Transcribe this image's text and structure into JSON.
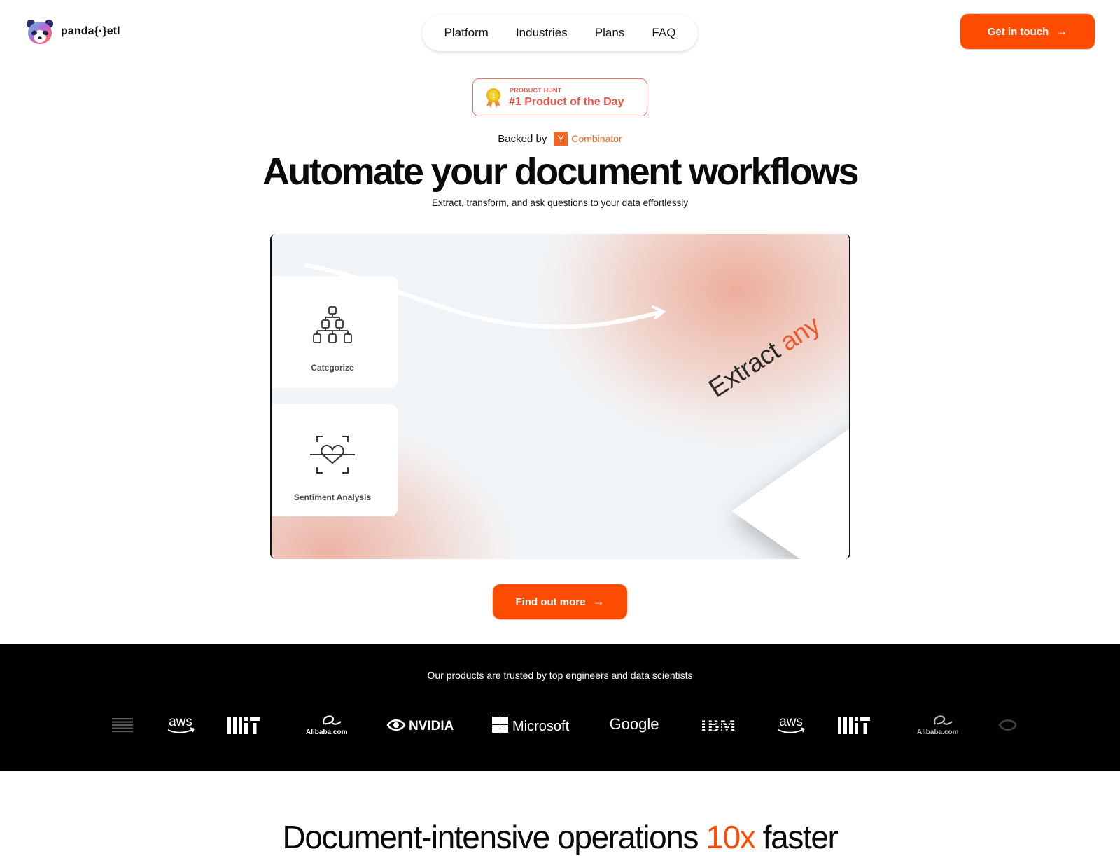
{
  "brand": {
    "name": "panda{·}etl",
    "accent_color": "#fc4c02"
  },
  "nav": {
    "items": [
      {
        "label": "Platform"
      },
      {
        "label": "Industries"
      },
      {
        "label": "Plans"
      },
      {
        "label": "FAQ"
      }
    ]
  },
  "header": {
    "cta_label": "Get in touch",
    "cta_icon": "arrow-right-icon"
  },
  "badge": {
    "small_label": "PRODUCT HUNT",
    "big_label": "#1 Product of the Day",
    "medal_number": "1",
    "icon": "medal-icon"
  },
  "backed_by": {
    "label": "Backed by",
    "yc_letter": "Y",
    "yc_name": "Combinator"
  },
  "hero": {
    "title": "Automate your document workflows",
    "subtitle": "Extract, transform, and ask questions to your data effortlessly",
    "cards": [
      {
        "label": "Categorize",
        "icon": "hierarchy-icon"
      },
      {
        "label": "Sentiment Analysis",
        "icon": "heart-scan-icon"
      }
    ],
    "visual_text": "Extract",
    "visual_text_accent": "any",
    "cta_label": "Find out more",
    "cta_icon": "arrow-right-icon"
  },
  "trusted": {
    "text": "Our products are trusted by top engineers and data scientists",
    "logos": [
      {
        "name": "IBM"
      },
      {
        "name": "aws"
      },
      {
        "name": "MIT"
      },
      {
        "name": "Alibaba.com"
      },
      {
        "name": "NVIDIA"
      },
      {
        "name": "Microsoft"
      },
      {
        "name": "Google"
      },
      {
        "name": "IBM"
      },
      {
        "name": "aws"
      },
      {
        "name": "MIT"
      },
      {
        "name": "Alibaba.com"
      },
      {
        "name": "NVIDIA"
      }
    ]
  },
  "section2": {
    "title_before": "Document-intensive operations ",
    "title_accent": "10x",
    "title_after": " faster"
  }
}
